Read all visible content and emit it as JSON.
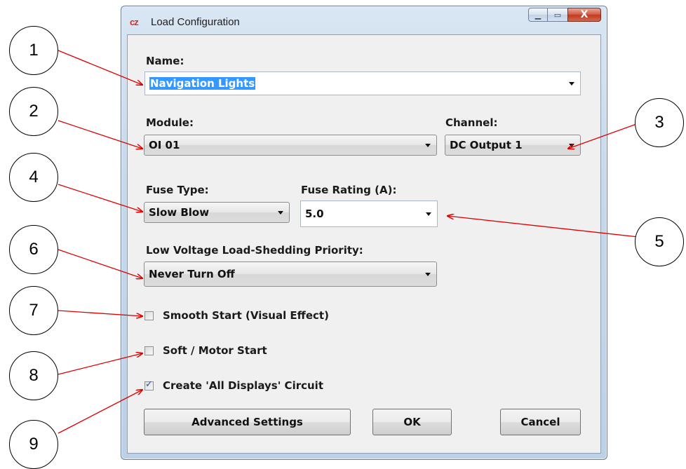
{
  "window": {
    "title": "Load Configuration",
    "app_icon_text": "cz",
    "controls": {
      "minimize": "▁",
      "maximize": "▭",
      "close": "X"
    }
  },
  "form": {
    "name_label": "Name:",
    "name_value": "Navigation Lights",
    "module_label": "Module:",
    "module_value": "OI 01",
    "channel_label": "Channel:",
    "channel_value": "DC Output 1",
    "fuse_type_label": "Fuse Type:",
    "fuse_type_value": "Slow Blow",
    "fuse_rating_label": "Fuse Rating (A):",
    "fuse_rating_value": "5.0",
    "priority_label": "Low Voltage Load-Shedding Priority:",
    "priority_value": "Never Turn Off",
    "smooth_start_label": "Smooth Start (Visual Effect)",
    "smooth_start_checked": false,
    "soft_start_label": "Soft / Motor Start",
    "soft_start_checked": false,
    "all_displays_label": "Create 'All Displays' Circuit",
    "all_displays_checked": true
  },
  "buttons": {
    "advanced": "Advanced Settings",
    "ok": "OK",
    "cancel": "Cancel"
  },
  "callouts": [
    "1",
    "2",
    "3",
    "4",
    "5",
    "6",
    "7",
    "8",
    "9"
  ],
  "colors": {
    "arrow": "#e00000",
    "selection": "#3399ff",
    "close_button": "#c23a1e"
  }
}
